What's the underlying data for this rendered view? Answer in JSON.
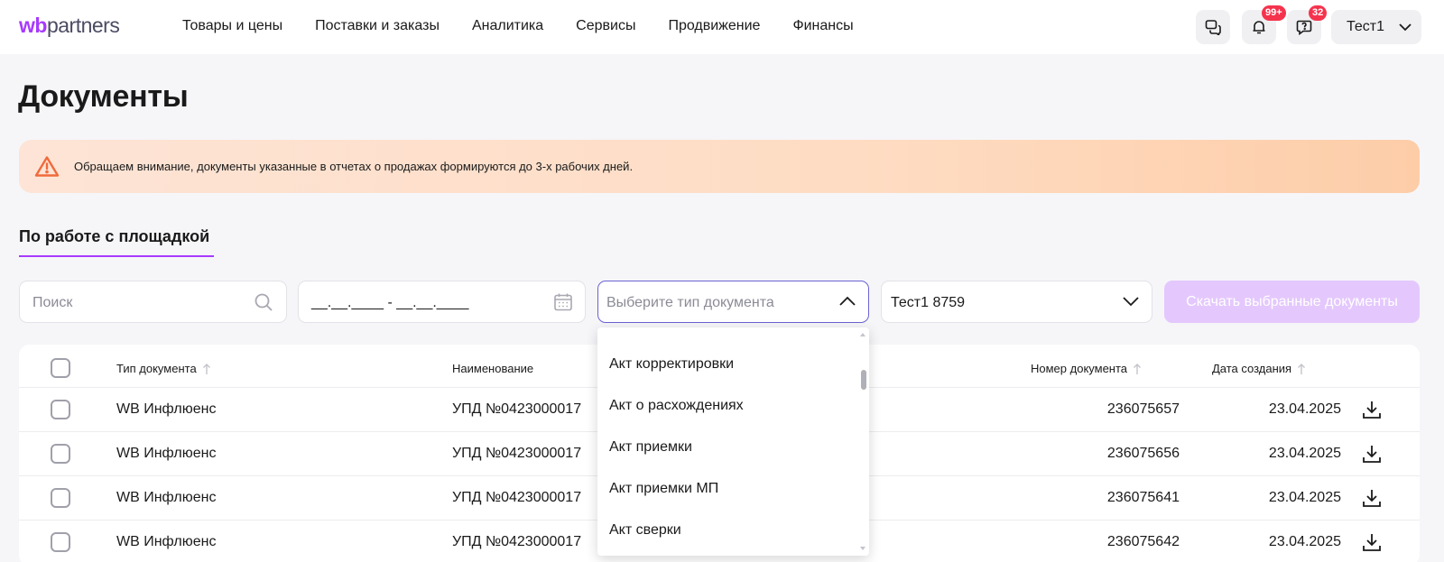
{
  "header": {
    "logo_wb": "wb",
    "logo_partners": "partners",
    "nav": [
      "Товары и цены",
      "Поставки и заказы",
      "Аналитика",
      "Сервисы",
      "Продвижение",
      "Финансы"
    ],
    "notifications_badge": "99+",
    "messages_badge": "32",
    "user_name": "Тест1"
  },
  "page": {
    "title": "Документы",
    "alert_text": "Обращаем внимание, документы указанные в отчетах о продажах формируются до 3-х рабочих дней.",
    "tab_label": "По работе с площадкой"
  },
  "filters": {
    "search_placeholder": "Поиск",
    "date_mask": "__.__.____ - __.__.____",
    "doctype_placeholder": "Выберите тип документа",
    "account_value": "Тест1 8759",
    "download_selected_label": "Скачать выбранные документы"
  },
  "dropdown": {
    "items": [
      "Акт корректировки",
      "Акт о расхождениях",
      "Акт приемки",
      "Акт приемки МП",
      "Акт сверки"
    ]
  },
  "table": {
    "headers": {
      "doc_type": "Тип документа",
      "name": "Наименование",
      "doc_number": "Номер документа",
      "created": "Дата создания"
    },
    "rows": [
      {
        "doc_type": "WB Инфлюенс",
        "name": "УПД №0423000017",
        "doc_number": "236075657",
        "created": "23.04.2025"
      },
      {
        "doc_type": "WB Инфлюенс",
        "name": "УПД №0423000017",
        "doc_number": "236075656",
        "created": "23.04.2025"
      },
      {
        "doc_type": "WB Инфлюенс",
        "name": "УПД №0423000017",
        "doc_number": "236075641",
        "created": "23.04.2025"
      },
      {
        "doc_type": "WB Инфлюенс",
        "name": "УПД №0423000017",
        "doc_number": "236075642",
        "created": "23.04.2025"
      }
    ]
  },
  "colors": {
    "accent": "#a73afd",
    "badge": "#f5334d",
    "focus_border": "#6a63d3",
    "alert_icon": "#f06b3b"
  }
}
